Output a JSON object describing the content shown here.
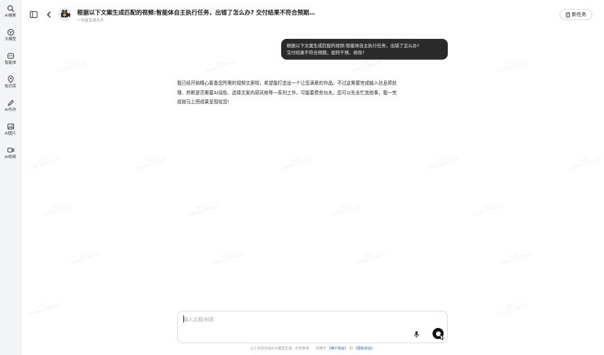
{
  "sidebar": {
    "items": [
      {
        "label": "AI搜索",
        "icon": "search-icon"
      },
      {
        "label": "大模型",
        "icon": "cube-icon"
      },
      {
        "label": "智能体",
        "icon": "bot-icon"
      },
      {
        "label": "知识库",
        "icon": "location-icon"
      },
      {
        "label": "AI写作",
        "icon": "pen-icon"
      },
      {
        "label": "AI图片",
        "icon": "image-icon"
      },
      {
        "label": "AI视频",
        "icon": "video-icon"
      }
    ]
  },
  "header": {
    "title": "根据以下文案生成匹配的视频:智能体自主执行任务，出错了怎么办? 交付结果不符合预期，...",
    "subtitle": "一句话生成大片",
    "new_task_label": "新任务"
  },
  "chat": {
    "user_message_lines": [
      "根据以下文案生成匹配的视频:智能体自主执行任务，出错了怎么办?",
      "交付结果不符合预期，如何干预、修改?"
    ],
    "assistant_message_lines": [
      "我已经开始精心筹备您所需的视频文案啦，希望能打造出一个让您满意的作品。不过这需要完成输入信息预处",
      "理、判断是否需要AI润色、选择文案内容风格等一系列工作，可能要费些功夫。您可以先去忙其他事，我一完",
      "成就马上把成果呈现给您!"
    ]
  },
  "input": {
    "placeholder": "输入主题/创意",
    "value": ""
  },
  "footer": {
    "disclaimer": "以上内容均由AI大模型生成，仅供参考",
    "agree_prefix": "请遵守",
    "user_agreement": "《用户协议》",
    "and": "和",
    "privacy_policy": "《隐私协议》"
  },
  "watermark": {
    "line1": "AIGC",
    "line2": "内容由人工智能生成"
  },
  "colors": {
    "user_bubble": "#2b2b2b",
    "link": "#1f5fbf",
    "rail_bg": "#f3f4f6"
  }
}
